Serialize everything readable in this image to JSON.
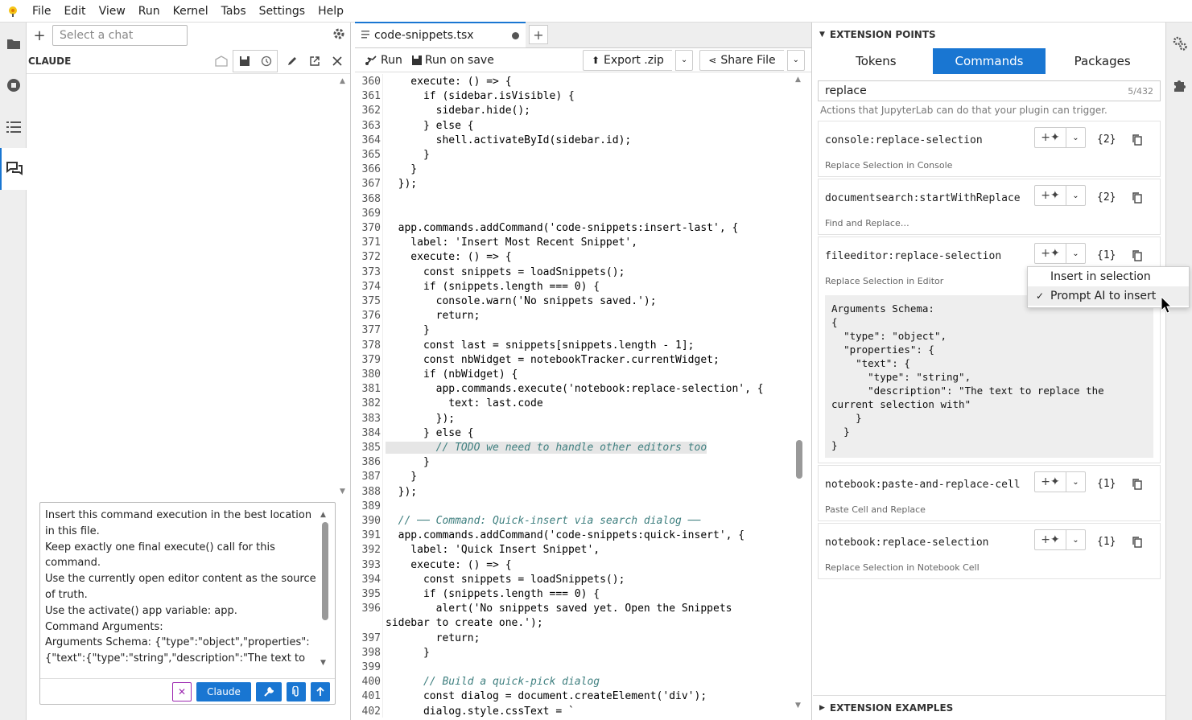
{
  "menu": [
    "File",
    "Edit",
    "View",
    "Run",
    "Kernel",
    "Tabs",
    "Settings",
    "Help"
  ],
  "chat": {
    "select_placeholder": "Select a chat",
    "title": "CLAUDE",
    "input_text": "Insert this command execution in the best location in this file.\nKeep exactly one final execute() call for this command.\nUse the currently open editor content as the source of truth.\nUse the activate() app variable: app.\nCommand Arguments:\nArguments Schema: {\"type\":\"object\",\"properties\":{\"text\":{\"type\":\"string\",\"description\":\"The text to replace the current selection with\"}}}\nCommand ID: fileeditor:replace-selection",
    "model_label": "Claude"
  },
  "editor": {
    "tab_name": "code-snippets.tsx",
    "run_label": "Run",
    "run_on_save_label": "Run on save",
    "export_label": "Export .zip",
    "share_label": "Share File",
    "lines": [
      {
        "n": "360",
        "t": "    execute: () => {"
      },
      {
        "n": "361",
        "t": "      if (sidebar.isVisible) {"
      },
      {
        "n": "362",
        "t": "        sidebar.hide();"
      },
      {
        "n": "363",
        "t": "      } else {"
      },
      {
        "n": "364",
        "t": "        shell.activateById(sidebar.id);"
      },
      {
        "n": "365",
        "t": "      }"
      },
      {
        "n": "366",
        "t": "    }"
      },
      {
        "n": "367",
        "t": "  });"
      },
      {
        "n": "368",
        "t": ""
      },
      {
        "n": "369",
        "t": ""
      },
      {
        "n": "370",
        "t": "  app.commands.addCommand('code-snippets:insert-last', {"
      },
      {
        "n": "371",
        "t": "    label: 'Insert Most Recent Snippet',"
      },
      {
        "n": "372",
        "t": "    execute: () => {"
      },
      {
        "n": "373",
        "t": "      const snippets = loadSnippets();"
      },
      {
        "n": "374",
        "t": "      if (snippets.length === 0) {"
      },
      {
        "n": "375",
        "t": "        console.warn('No snippets saved.');"
      },
      {
        "n": "376",
        "t": "        return;"
      },
      {
        "n": "377",
        "t": "      }"
      },
      {
        "n": "378",
        "t": "      const last = snippets[snippets.length - 1];"
      },
      {
        "n": "379",
        "t": "      const nbWidget = notebookTracker.currentWidget;"
      },
      {
        "n": "380",
        "t": "      if (nbWidget) {"
      },
      {
        "n": "381",
        "t": "        app.commands.execute('notebook:replace-selection', {"
      },
      {
        "n": "382",
        "t": "          text: last.code"
      },
      {
        "n": "383",
        "t": "        });"
      },
      {
        "n": "384",
        "t": "      } else {"
      },
      {
        "n": "385",
        "t": "        // TODO we need to handle other editors too"
      },
      {
        "n": "386",
        "t": "      }"
      },
      {
        "n": "387",
        "t": "    }"
      },
      {
        "n": "388",
        "t": "  });"
      },
      {
        "n": "389",
        "t": ""
      },
      {
        "n": "390",
        "t": "  // ── Command: Quick-insert via search dialog ──"
      },
      {
        "n": "391",
        "t": "  app.commands.addCommand('code-snippets:quick-insert', {"
      },
      {
        "n": "392",
        "t": "    label: 'Quick Insert Snippet',"
      },
      {
        "n": "393",
        "t": "    execute: () => {"
      },
      {
        "n": "394",
        "t": "      const snippets = loadSnippets();"
      },
      {
        "n": "395",
        "t": "      if (snippets.length === 0) {"
      },
      {
        "n": "396",
        "t": "        alert('No snippets saved yet. Open the Snippets"
      },
      {
        "n": "",
        "t": "sidebar to create one.');"
      },
      {
        "n": "397",
        "t": "        return;"
      },
      {
        "n": "398",
        "t": "      }"
      },
      {
        "n": "399",
        "t": ""
      },
      {
        "n": "400",
        "t": "      // Build a quick-pick dialog"
      },
      {
        "n": "401",
        "t": "      const dialog = document.createElement('div');"
      },
      {
        "n": "402",
        "t": "      dialog.style.cssText = `"
      }
    ]
  },
  "ext": {
    "header": "EXTENSION POINTS",
    "tabs": [
      "Tokens",
      "Commands",
      "Packages"
    ],
    "search_value": "replace",
    "search_count": "5/432",
    "hint": "Actions that JupyterLab can do that your plugin can trigger.",
    "commands": [
      {
        "name": "console:replace-selection",
        "desc": "Replace Selection in Console",
        "args": "{2}"
      },
      {
        "name": "documentsearch:startWithReplace",
        "desc": "Find and Replace…",
        "args": "{2}"
      },
      {
        "name": "fileeditor:replace-selection",
        "desc": "Replace Selection in Editor",
        "args": "{1}"
      },
      {
        "name": "notebook:paste-and-replace-cell",
        "desc": "Paste Cell and Replace",
        "args": "{1}"
      },
      {
        "name": "notebook:replace-selection",
        "desc": "Replace Selection in Notebook Cell",
        "args": "{1}"
      }
    ],
    "schema": "Arguments Schema:\n{\n  \"type\": \"object\",\n  \"properties\": {\n    \"text\": {\n      \"type\": \"string\",\n      \"description\": \"The text to replace the\ncurrent selection with\"\n    }\n  }\n}",
    "popup": [
      "Insert in selection",
      "Prompt AI to insert"
    ],
    "footer": "EXTENSION EXAMPLES"
  }
}
